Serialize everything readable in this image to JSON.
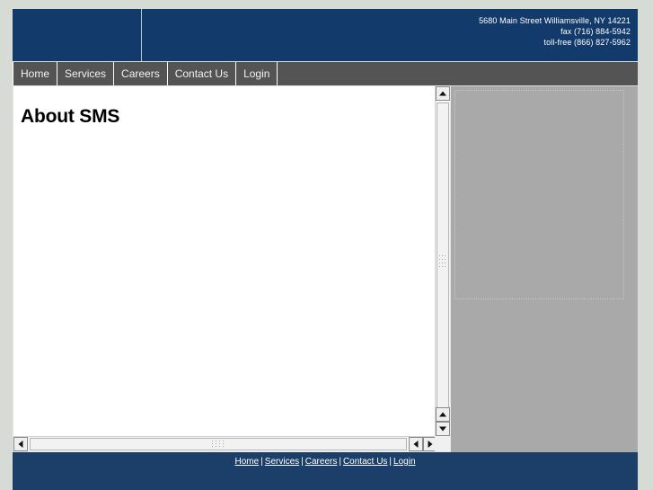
{
  "header": {
    "contact": {
      "address": "5680 Main Street Williamsville, NY 14221",
      "fax": "fax (716) 884-5942",
      "tollfree": "toll-free (866) 827-5962"
    },
    "logo_alt": ""
  },
  "nav": {
    "items": [
      {
        "label": "Home"
      },
      {
        "label": "Services"
      },
      {
        "label": "Careers"
      },
      {
        "label": "Contact Us"
      },
      {
        "label": "Login"
      }
    ]
  },
  "content": {
    "page_title": "About SMS"
  },
  "scrollbars": {
    "vertical": {
      "up_icon": "triangle-up-icon",
      "down_icon": "triangle-down-icon"
    },
    "horizontal": {
      "left_icon": "triangle-left-icon",
      "right_icon": "triangle-right-icon"
    }
  },
  "footer": {
    "links": [
      {
        "label": "Home"
      },
      {
        "label": "Services"
      },
      {
        "label": "Careers"
      },
      {
        "label": "Contact Us"
      },
      {
        "label": "Login"
      }
    ],
    "separator": "|"
  },
  "colors": {
    "brand_blue": "#123a6b",
    "footer_blue": "#1b3f69",
    "nav_gray": "#545454",
    "panel_gray": "#a9a9a9",
    "page_background": "#d6dbd6"
  }
}
